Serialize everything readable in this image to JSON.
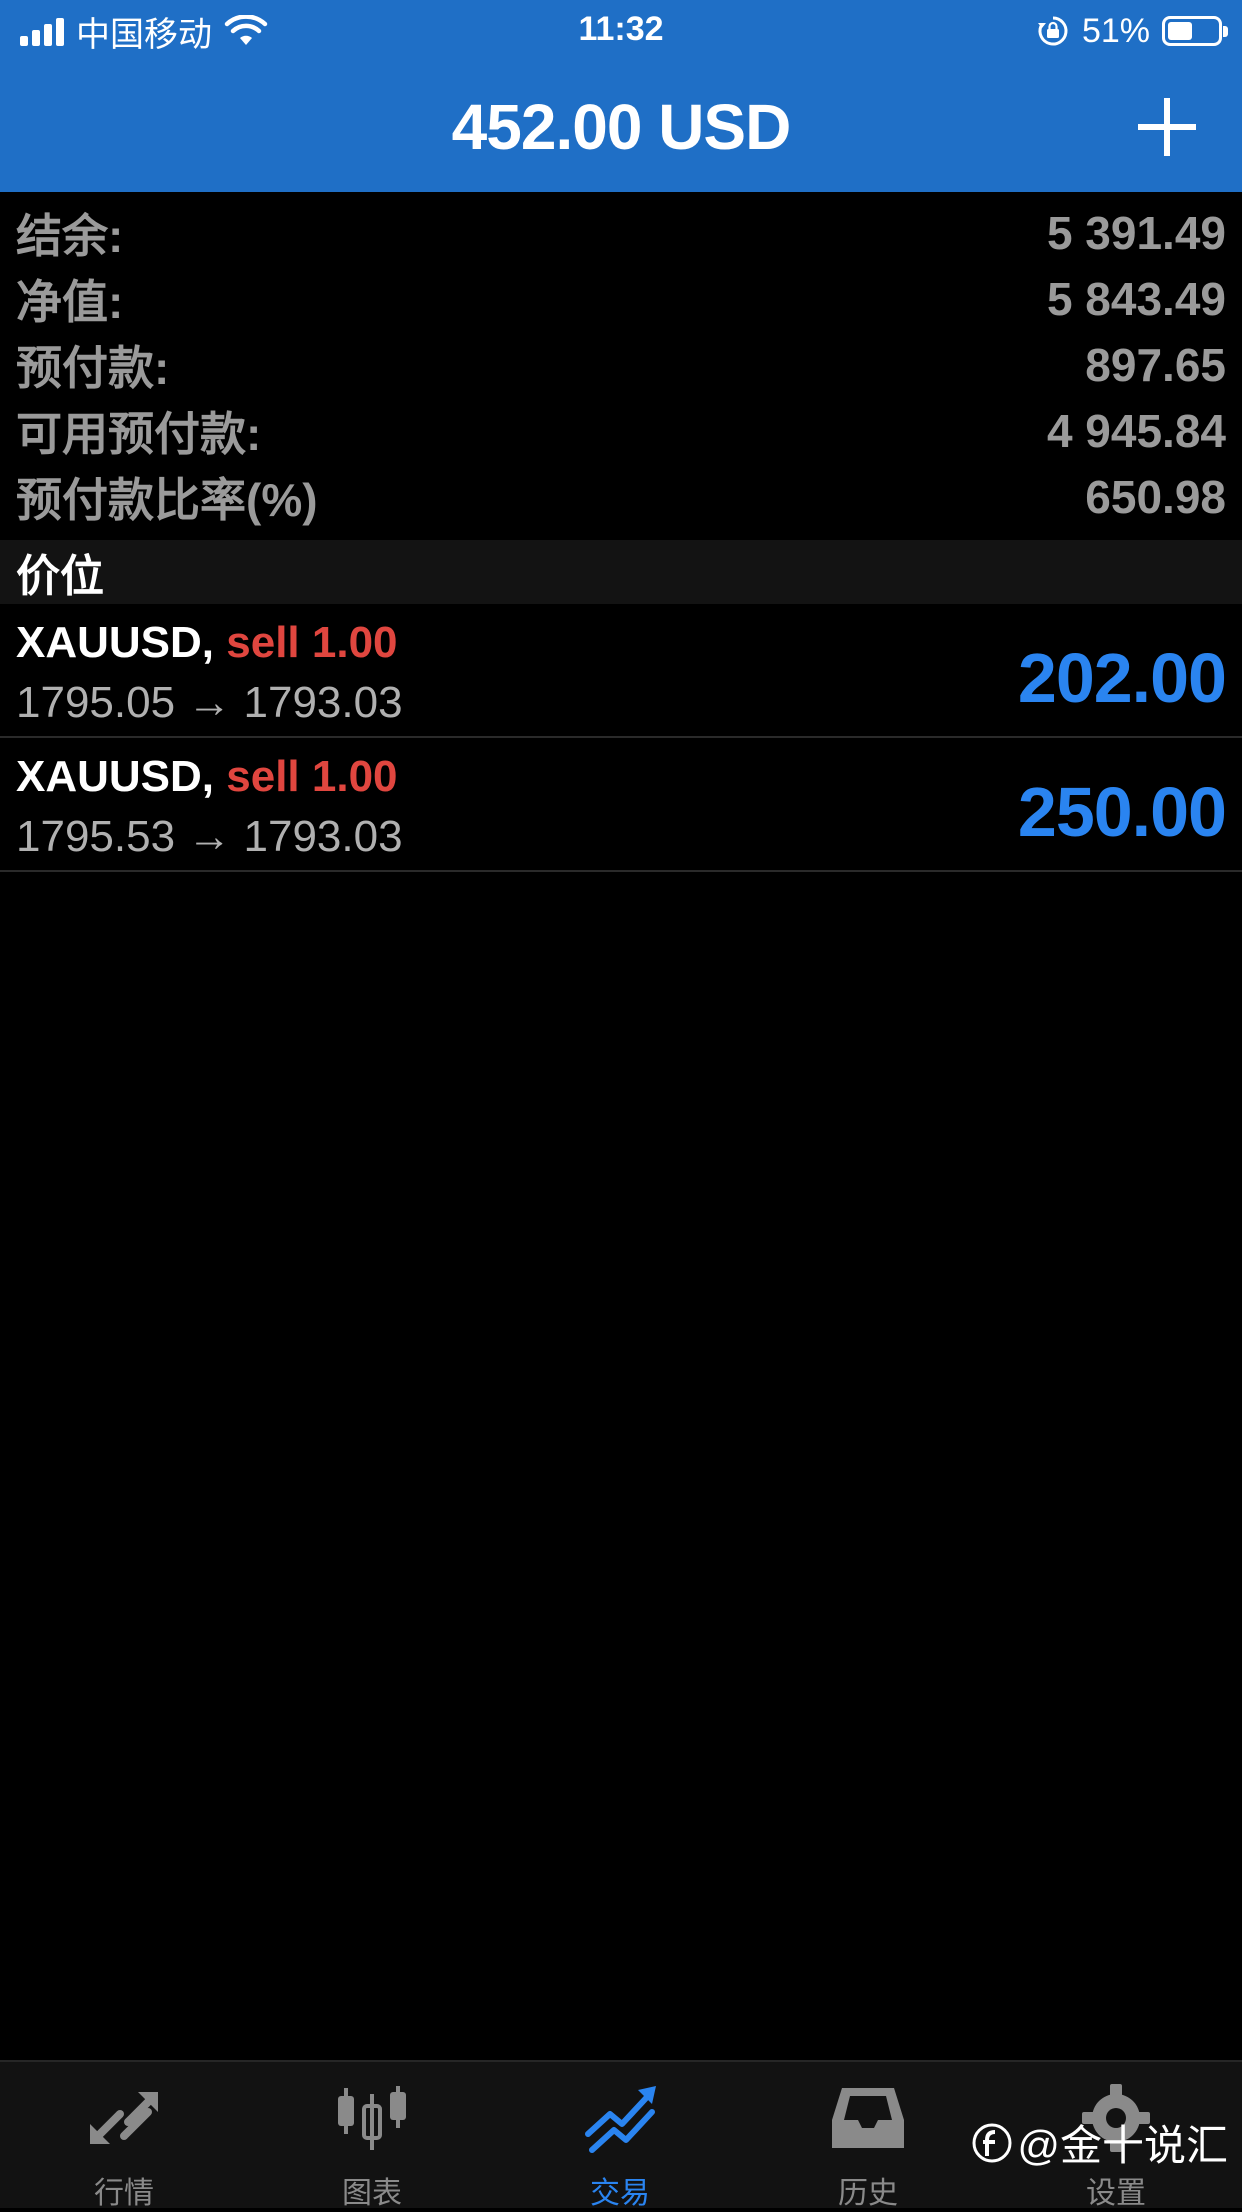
{
  "status_bar": {
    "carrier": "中国移动",
    "time": "11:32",
    "battery_text": "51%",
    "battery_level": 0.51
  },
  "header": {
    "title": "452.00 USD",
    "add_icon": "plus-icon"
  },
  "summary": [
    {
      "label": "结余:",
      "value": "5 391.49"
    },
    {
      "label": "净值:",
      "value": "5 843.49"
    },
    {
      "label": "预付款:",
      "value": "897.65"
    },
    {
      "label": "可用预付款:",
      "value": "4 945.84"
    },
    {
      "label": "预付款比率(%)",
      "value": "650.98"
    }
  ],
  "positions_section": {
    "title": "价位"
  },
  "positions": [
    {
      "symbol": "XAUUSD,",
      "side": "sell 1.00",
      "prices": "1795.05 → 1793.03",
      "profit": "202.00"
    },
    {
      "symbol": "XAUUSD,",
      "side": "sell 1.00",
      "prices": "1795.53 → 1793.03",
      "profit": "250.00"
    }
  ],
  "tabs": [
    {
      "label": "行情",
      "icon": "quotes-arrows-icon",
      "active": false
    },
    {
      "label": "图表",
      "icon": "candlestick-chart-icon",
      "active": false
    },
    {
      "label": "交易",
      "icon": "trade-trend-icon",
      "active": true
    },
    {
      "label": "历史",
      "icon": "history-inbox-icon",
      "active": false
    },
    {
      "label": "设置",
      "icon": "gear-icon",
      "active": false
    }
  ],
  "watermark": {
    "text": "@金十说汇"
  },
  "colors": {
    "header_bg": "#1f6fc6",
    "profit": "#2a84f0",
    "sell": "#e0463f",
    "label_gray": "#9a9a9a",
    "active_tab": "#2a84f0",
    "inactive_tab": "#8a8a8a"
  }
}
